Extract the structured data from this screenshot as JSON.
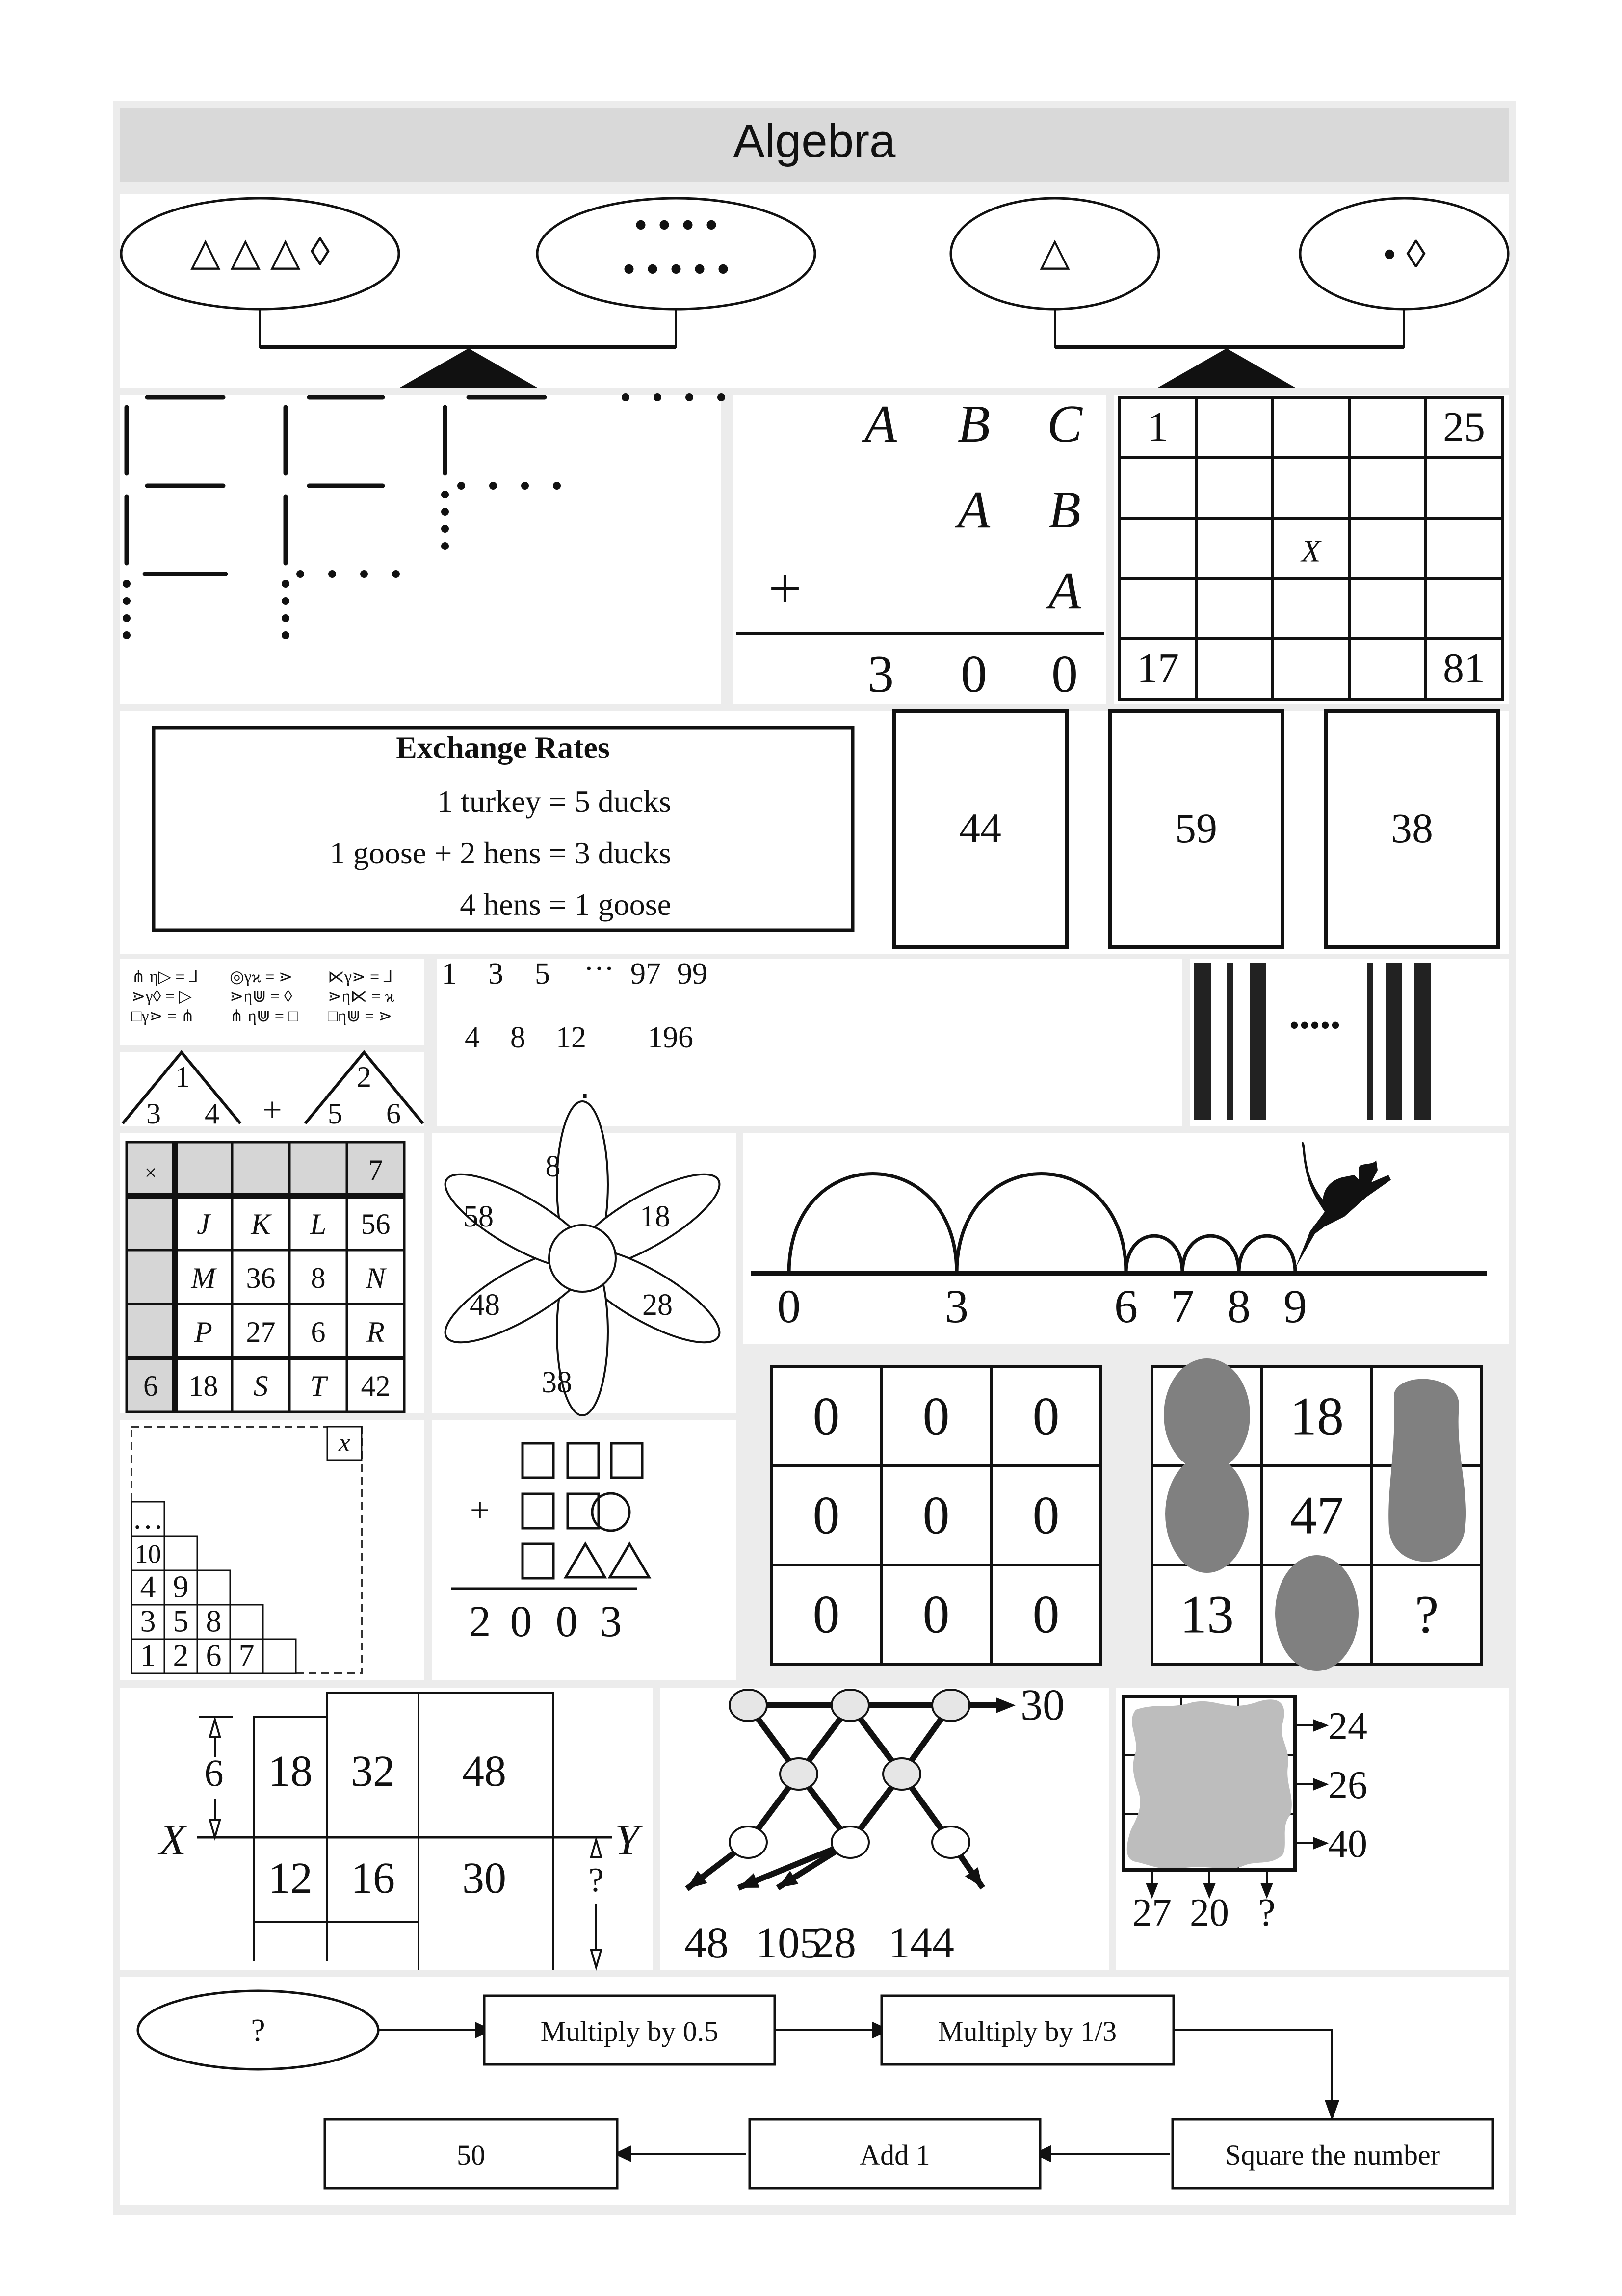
{
  "title": "Algebra",
  "colors": {
    "frame": "#ececec",
    "title_bar": "#d9d9d9",
    "panel": "#ffffff",
    "ink": "#111111",
    "blob_dark": "#808080",
    "blob_light": "#bdbdbd",
    "node_fill": "#e6e6e6"
  },
  "balance": {
    "left_scale": {
      "left_pan": "△ △ △ ◊",
      "right_pan_top": "• • • •",
      "right_pan_bottom": "• • • • •"
    },
    "right_scale": {
      "left_pan": "△",
      "right_pan": "• ◊"
    },
    "icons": [
      "triangle-icon",
      "diamond-icon",
      "dot-icon",
      "fulcrum-icon"
    ]
  },
  "matchsticks": {
    "description": "staircase of matchstick squares continuing with dots"
  },
  "cryptarithm": {
    "rows": [
      [
        "A",
        "B",
        "C"
      ],
      [
        "",
        "A",
        "B"
      ],
      [
        "+",
        "",
        "A"
      ]
    ],
    "result": [
      "3",
      "0",
      "0"
    ]
  },
  "number_grid": {
    "cells": [
      [
        "1",
        "",
        "",
        "",
        "25"
      ],
      [
        "",
        "",
        "",
        "",
        ""
      ],
      [
        "",
        "",
        "X",
        "",
        ""
      ],
      [
        "",
        "",
        "",
        "",
        ""
      ],
      [
        "17",
        "",
        "",
        "",
        "81"
      ]
    ]
  },
  "exchange_rates": {
    "title": "Exchange Rates",
    "lines": [
      "1 turkey = 5 ducks",
      "1 goose + 2 hens = 3 ducks",
      "4 hens = 1 goose"
    ]
  },
  "cards": [
    "44",
    "59",
    "38"
  ],
  "symbol_equations": [
    [
      "⋔ η▷ = ⅃",
      "◎γϰ = ⋗",
      "⋉γ⋗ = ⅃"
    ],
    [
      "⋗γ◊ = ▷",
      "⋗η⋓ = ◊",
      "⋗η⋉ = ϰ"
    ],
    [
      "□γ⋗ = ⋔",
      "⋔ η⋓ = □",
      "□η⋓ = ⋗"
    ]
  ],
  "triangles": {
    "left": {
      "top": "1",
      "bl": "3",
      "br": "4"
    },
    "op": "+",
    "right": {
      "top": "2",
      "bl": "5",
      "br": "6"
    }
  },
  "sequence": {
    "row1": [
      "1",
      "3",
      "5",
      "···",
      "97",
      "99"
    ],
    "row2": [
      "4",
      "8",
      "12",
      "196"
    ],
    "vdots": "⋮"
  },
  "barcode": {
    "dots": "•••••"
  },
  "mult_table": {
    "header": [
      "×",
      "",
      "",
      "",
      "7"
    ],
    "rows": [
      [
        "",
        "J",
        "K",
        "L",
        "56"
      ],
      [
        "",
        "M",
        "36",
        "8",
        "N"
      ],
      [
        "",
        "P",
        "27",
        "6",
        "R"
      ],
      [
        "6",
        "18",
        "S",
        "T",
        "42"
      ]
    ]
  },
  "flower": {
    "petals": [
      "8",
      "18",
      "28",
      "38",
      "48",
      "58"
    ]
  },
  "number_line": {
    "labels": [
      "0",
      "3",
      "6",
      "7",
      "8",
      "9"
    ]
  },
  "staircase": {
    "corner": "x",
    "rows": [
      [
        "…"
      ],
      [
        "10",
        ""
      ],
      [
        "4",
        "9",
        ""
      ],
      [
        "3",
        "5",
        "8",
        ""
      ],
      [
        "1",
        "2",
        "6",
        "7",
        ""
      ]
    ]
  },
  "shape_sum": {
    "plus": "+",
    "result": [
      "2",
      "0",
      "0",
      "3"
    ]
  },
  "zero_grid": {
    "cells": [
      [
        "0",
        "0",
        "0"
      ],
      [
        "0",
        "0",
        "0"
      ],
      [
        "0",
        "0",
        "0"
      ]
    ]
  },
  "blob_grid": {
    "cells": [
      [
        "",
        "18",
        ""
      ],
      [
        "",
        "47",
        ""
      ],
      [
        "13",
        "",
        "?"
      ]
    ]
  },
  "rect_puzzle": {
    "x_label": "X",
    "y_label": "Y",
    "height_label": "6",
    "unknown_label": "?",
    "top": [
      "18",
      "32",
      "48"
    ],
    "bottom": [
      "12",
      "16",
      "30"
    ]
  },
  "network": {
    "right_value": "30",
    "bottom_values": [
      "48",
      "105",
      "28",
      "144"
    ]
  },
  "hidden_grid": {
    "row_sums": [
      "24",
      "26",
      "40"
    ],
    "col_sums": [
      "27",
      "20",
      "?"
    ]
  },
  "flowchart": {
    "start": "?",
    "steps_top": [
      "Multiply by 0.5",
      "Multiply by 1/3"
    ],
    "steps_bottom": [
      "Square the number",
      "Add 1",
      "50"
    ]
  }
}
